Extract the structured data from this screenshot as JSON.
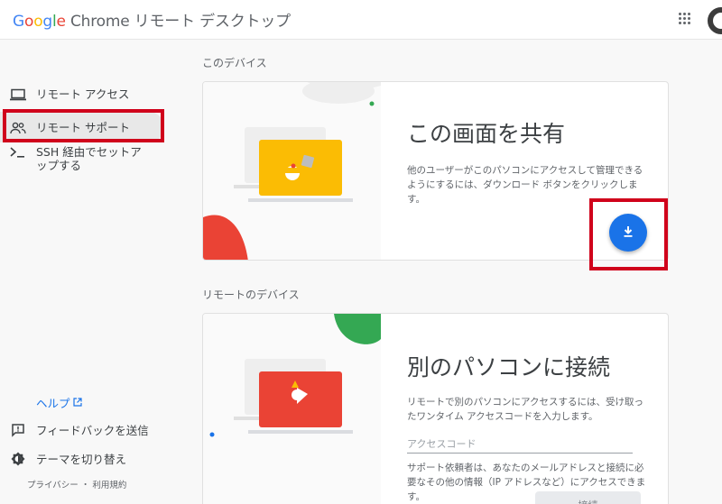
{
  "header": {
    "logo_google": [
      "G",
      "o",
      "o",
      "g",
      "l",
      "e"
    ],
    "app_title": "Chrome リモート デスクトップ"
  },
  "sidebar": {
    "items": [
      {
        "label": "リモート アクセス",
        "icon": "laptop-icon"
      },
      {
        "label": "リモート サポート",
        "icon": "people-icon"
      },
      {
        "label": "SSH 経由でセットアップする",
        "icon": "terminal-icon"
      }
    ],
    "help": "ヘルプ",
    "bottom": [
      {
        "label": "フィードバックを送信",
        "icon": "feedback-icon"
      },
      {
        "label": "テーマを切り替え",
        "icon": "theme-icon"
      }
    ],
    "footer": "プライバシー ・ 利用規約"
  },
  "main": {
    "section_this_device": "このデバイス",
    "share": {
      "title": "この画面を共有",
      "description": "他のユーザーがこのパソコンにアクセスして管理できるようにするには、ダウンロード ボタンをクリックします。"
    },
    "section_remote_device": "リモートのデバイス",
    "connect": {
      "title": "別のパソコンに接続",
      "description": "リモートで別のパソコンにアクセスするには、受け取ったワンタイム アクセスコードを入力します。",
      "input_placeholder": "アクセスコード",
      "hint": "サポート依頼者は、あなたのメールアドレスと接続に必要なその他の情報（IP アドレスなど）にアクセスできます。",
      "button_label": "接続"
    }
  },
  "colors": {
    "accent": "#1a73e8",
    "highlight": "#d0021b",
    "yellow": "#fbbc04",
    "red": "#ea4335",
    "green": "#34a853"
  }
}
